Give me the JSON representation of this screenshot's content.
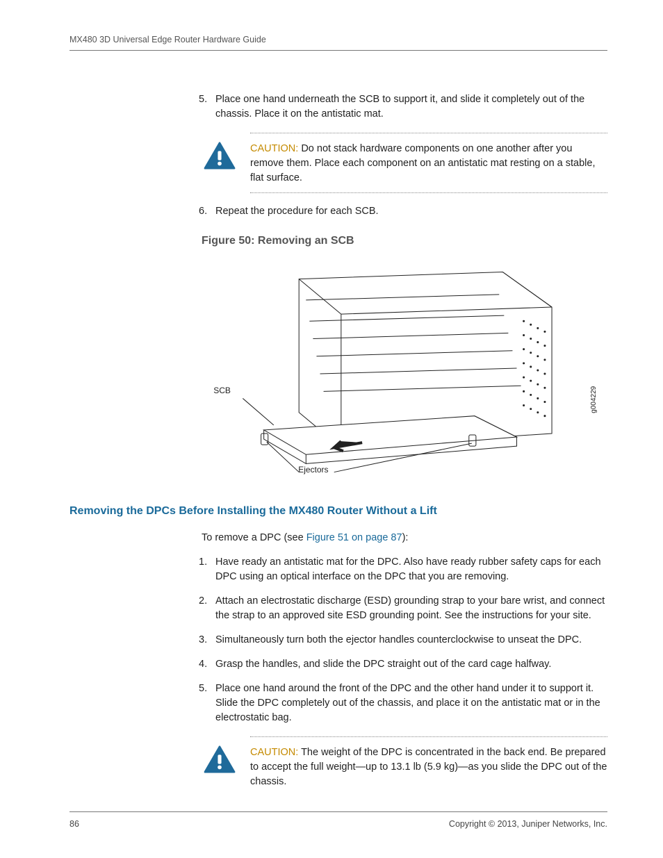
{
  "header": {
    "running": "MX480 3D Universal Edge Router Hardware Guide"
  },
  "step5": "Place one hand underneath the SCB to support it, and slide it completely out of the chassis. Place it on the antistatic mat.",
  "caution1": {
    "label": "CAUTION:",
    "text": "Do not stack hardware components on one another after you remove them. Place each component on an antistatic mat resting on a stable, flat surface."
  },
  "step6": "Repeat the procedure for each SCB.",
  "figure": {
    "title": "Figure 50: Removing an SCB",
    "label_scb": "SCB",
    "label_ejectors": "Ejectors",
    "label_code": "g004229"
  },
  "section": {
    "heading": "Removing the DPCs Before Installing the MX480 Router Without a Lift",
    "intro_pre": "To remove a DPC (see ",
    "intro_link": "Figure 51 on page 87",
    "intro_post": "):",
    "steps": [
      "Have ready an antistatic mat for the DPC. Also have ready rubber safety caps for each DPC using an optical interface on the DPC that you are removing.",
      "Attach an electrostatic discharge (ESD) grounding strap to your bare wrist, and connect the strap to an approved site ESD grounding point. See the instructions for your site.",
      "Simultaneously turn both the ejector handles counterclockwise to unseat the DPC.",
      "Grasp the handles, and slide the DPC straight out of the card cage halfway.",
      "Place one hand around the front of the DPC and the other hand under it to support it. Slide the DPC completely out of the chassis, and place it on the antistatic mat or in the electrostatic bag."
    ]
  },
  "caution2": {
    "label": "CAUTION:",
    "text": "The weight of the DPC is concentrated in the back end. Be prepared to accept the full weight—up to 13.1 lb (5.9 kg)—as you slide the DPC out of the chassis."
  },
  "footer": {
    "page": "86",
    "copyright": "Copyright © 2013, Juniper Networks, Inc."
  }
}
